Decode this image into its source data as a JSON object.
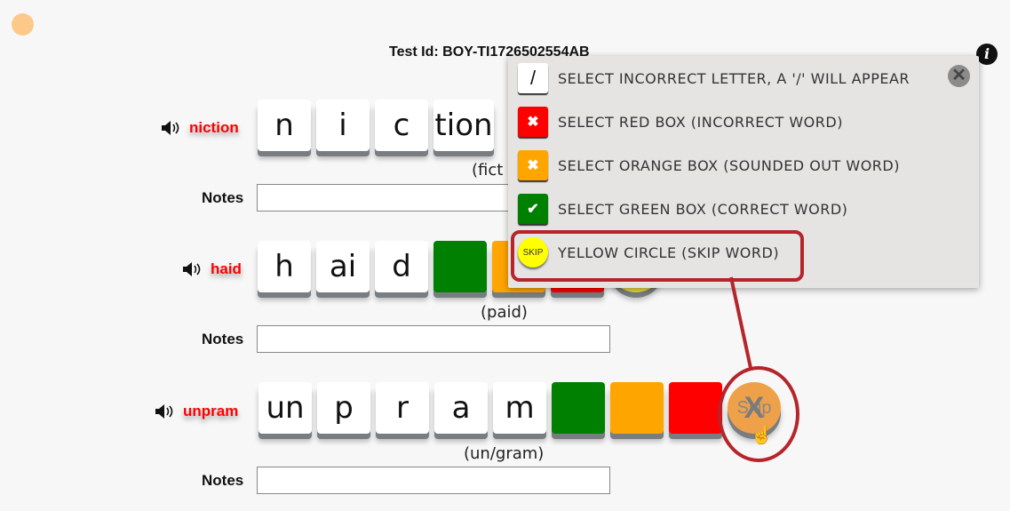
{
  "header": {
    "test_id": "Test Id: BOY-TI1726502554AB",
    "info_icon": "info-icon"
  },
  "rows": [
    {
      "word": "niction",
      "tiles": [
        "n",
        "i",
        "c",
        "tion"
      ],
      "caption": "(fict",
      "notes_label": "Notes",
      "notes_value": ""
    },
    {
      "word": "haid",
      "tiles": [
        "h",
        "ai",
        "d"
      ],
      "caption": "(paid)",
      "notes_label": "Notes",
      "notes_value": ""
    },
    {
      "word": "unpram",
      "tiles": [
        "un",
        "p",
        "r",
        "a",
        "m"
      ],
      "caption": "(un/gram)",
      "notes_label": "Notes",
      "notes_value": "",
      "skip_label": "Skip"
    }
  ],
  "legend": {
    "items": [
      {
        "swatch": "/",
        "text": "SELECT INCORRECT LETTER, A '/' WILL APPEAR"
      },
      {
        "swatch": "✖",
        "text": "SELECT RED BOX (INCORRECT WORD)"
      },
      {
        "swatch": "✖",
        "text": "SELECT ORANGE BOX (SOUNDED OUT WORD)"
      },
      {
        "swatch": "✔",
        "text": "SELECT GREEN BOX (CORRECT WORD)"
      },
      {
        "swatch": "SKIP",
        "text": "YELLOW CIRCLE (SKIP WORD)"
      }
    ],
    "close": "✕"
  },
  "colors": {
    "correct": "#008000",
    "sounded_out": "#ffa500",
    "incorrect": "#ff0000",
    "skip": "#ffff00",
    "highlight": "#b5252b"
  }
}
